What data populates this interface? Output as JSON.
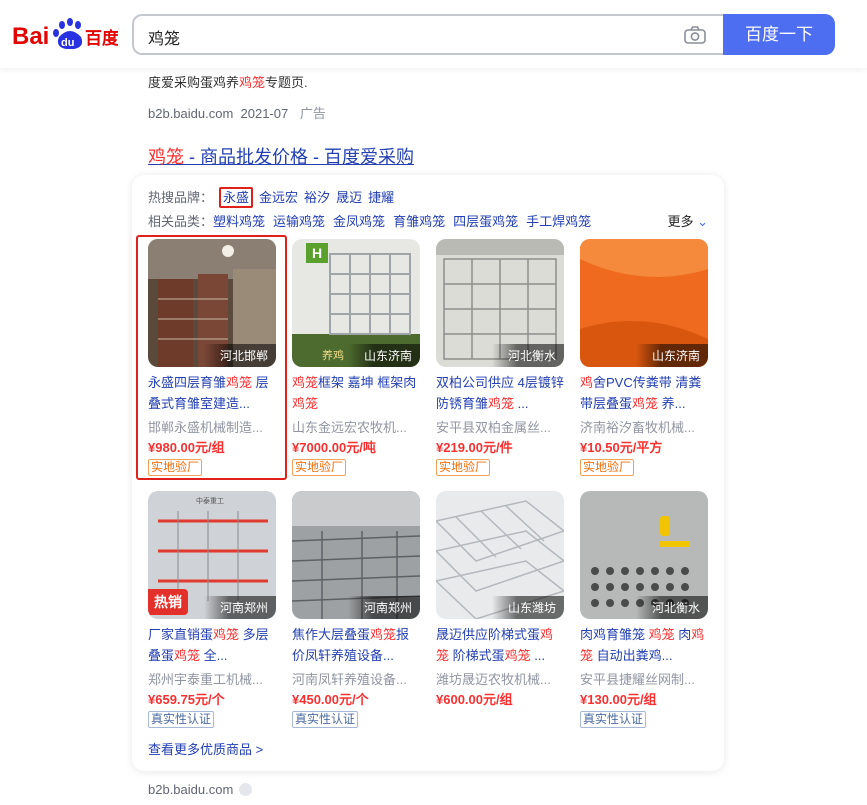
{
  "header": {
    "logo_text": "Bai du 百度",
    "search_value": "鸡笼",
    "search_button": "百度一下",
    "colors": {
      "brand_red": "#e10602",
      "brand_blue": "#2932e1",
      "button": "#4e6ef2"
    }
  },
  "prev_result": {
    "snippet_pre": "度爱采购蛋鸡养",
    "snippet_kw": "鸡笼",
    "snippet_post": "专题页.",
    "source": "b2b.baidu.com",
    "date": "2021-07",
    "ad_label": "广告"
  },
  "result": {
    "title_kw": "鸡笼",
    "title_rest": " - 商品批发价格 - 百度爱采购",
    "brands_label": "热搜品牌：",
    "brands": [
      "永盛",
      "金远宏",
      "裕汐",
      "晟迈",
      "捷耀"
    ],
    "cats_label": "相关品类：",
    "categories": [
      "塑料鸡笼",
      "运输鸡笼",
      "金凤鸡笼",
      "育雏鸡笼",
      "四层蛋鸡笼",
      "手工焊鸡笼"
    ],
    "more_label": "更多",
    "more_products": "查看更多优质商品 >",
    "footer_source": "b2b.baidu.com"
  },
  "products": [
    {
      "location": "河北邯郸",
      "name_parts": [
        "永盛四层育雏",
        "鸡笼",
        " 层叠式育雏室建造..."
      ],
      "company": "邯郸永盛机械制造...",
      "price": "¥980.00元/组",
      "tag": "实地验厂"
    },
    {
      "location": "山东济南",
      "name_parts": [
        "",
        "鸡笼",
        "框架 嘉坤 框架肉",
        "鸡笼",
        ""
      ],
      "company": "山东金远宏农牧机...",
      "price": "¥7000.00元/吨",
      "tag": "实地验厂"
    },
    {
      "location": "河北衡水",
      "name_parts": [
        "双柏公司供应 4层镀锌防锈育雏",
        "鸡笼",
        " ..."
      ],
      "company": "安平县双柏金属丝...",
      "price": "¥219.00元/件",
      "tag": "实地验厂"
    },
    {
      "location": "山东济南",
      "name_parts": [
        "",
        "鸡",
        "舍PVC传粪带 清粪带层叠蛋",
        "鸡笼",
        " 养..."
      ],
      "company": "济南裕汐畜牧机械...",
      "price": "¥10.50元/平方",
      "tag": "实地验厂"
    },
    {
      "location": "河南郑州",
      "hot": "热销",
      "name_parts": [
        "厂家直销蛋",
        "鸡笼",
        " 多层叠蛋",
        "鸡笼",
        " 全..."
      ],
      "company": "郑州宇泰重工机械...",
      "price": "¥659.75元/个",
      "tag": "真实性认证"
    },
    {
      "location": "河南郑州",
      "name_parts": [
        "焦作大层叠蛋",
        "鸡笼",
        "报价凤轩养殖设备..."
      ],
      "company": "河南凤轩养殖设备...",
      "price": "¥450.00元/个",
      "tag": "真实性认证"
    },
    {
      "location": "山东潍坊",
      "name_parts": [
        "晟迈供应阶梯式蛋",
        "鸡笼",
        " 阶梯式蛋",
        "鸡笼",
        " ..."
      ],
      "company": "潍坊晟迈农牧机械...",
      "price": "¥600.00元/组",
      "tag": ""
    },
    {
      "location": "河北衡水",
      "name_parts": [
        "肉鸡育雏笼 ",
        "鸡笼",
        " 肉",
        "鸡笼",
        " 自动出粪鸡..."
      ],
      "company": "安平县捷耀丝网制...",
      "price": "¥130.00元/组",
      "tag": "真实性认证"
    }
  ],
  "product1_logo_text": "H",
  "product1_caption": "养鸡",
  "product2_caption": "中泰重工"
}
